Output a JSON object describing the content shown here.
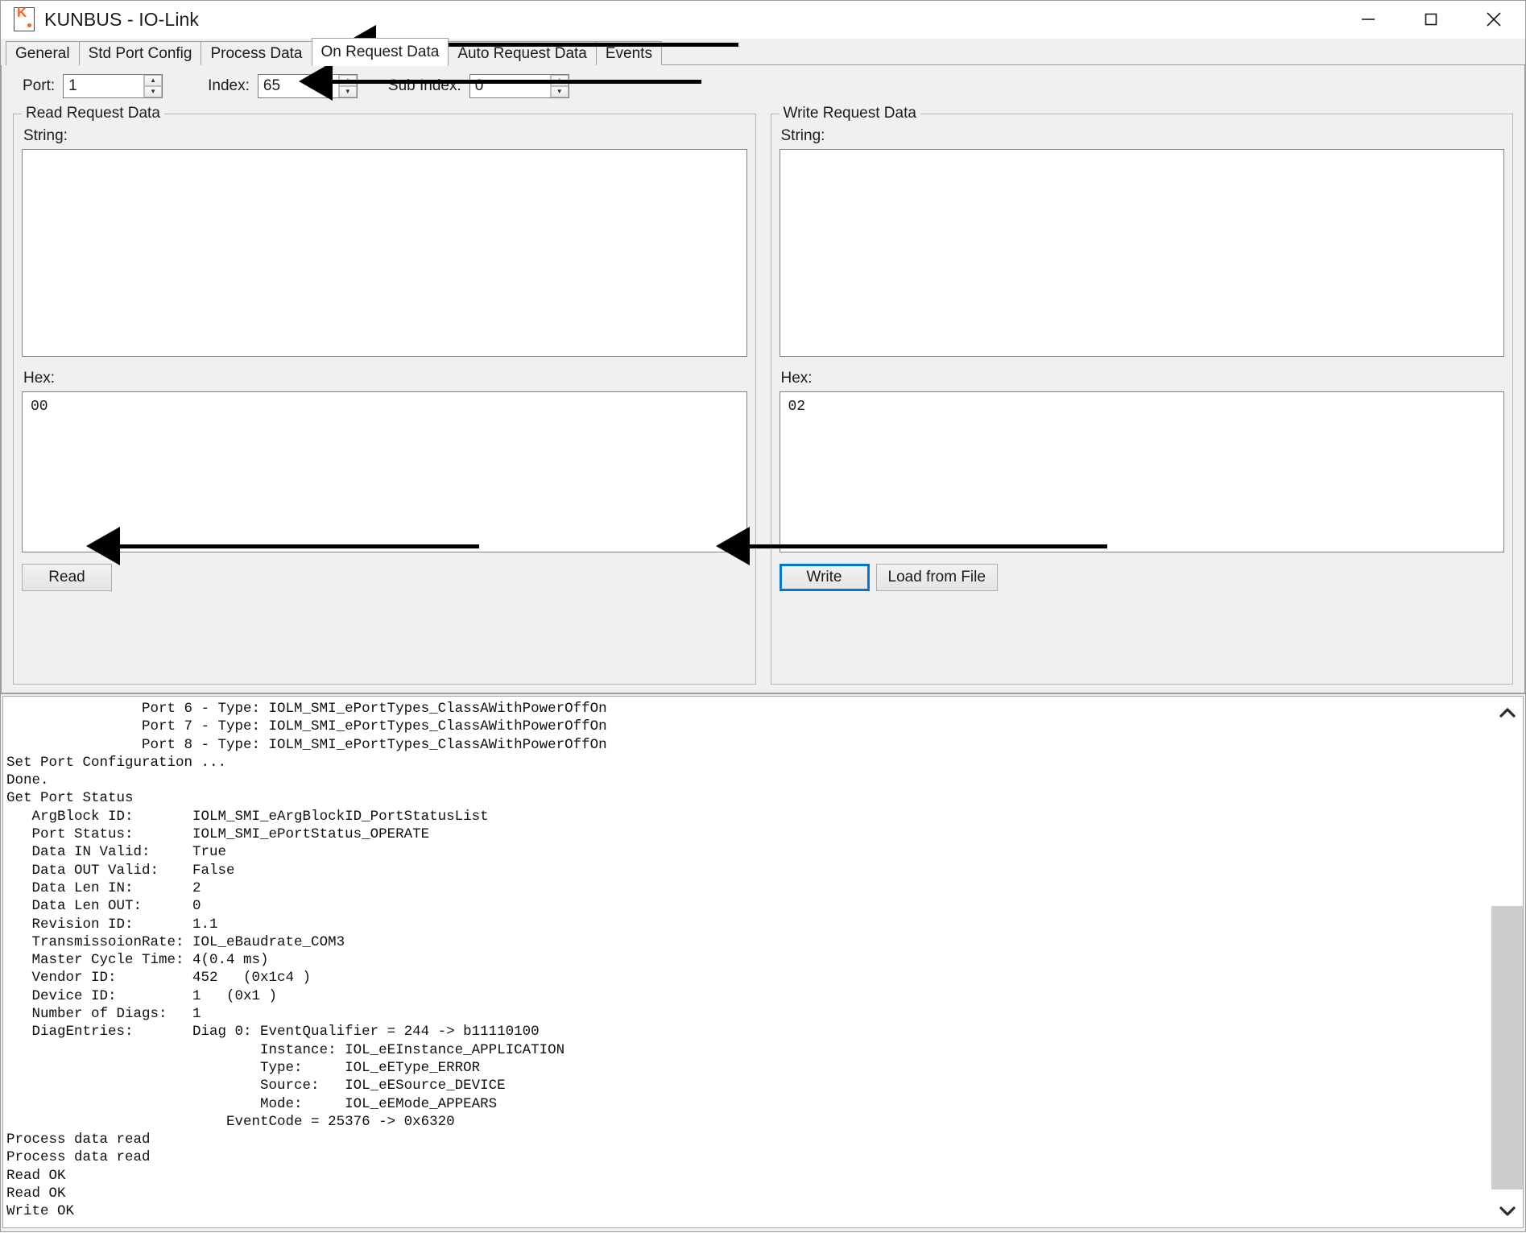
{
  "window": {
    "title": "KUNBUS - IO-Link",
    "icon": "kunbus-logo-icon",
    "controls": {
      "minimize": "minimize-icon",
      "maximize": "maximize-icon",
      "close": "close-icon"
    }
  },
  "tabs": [
    {
      "label": "General",
      "active": false
    },
    {
      "label": "Std Port Config",
      "active": false
    },
    {
      "label": "Process Data",
      "active": false
    },
    {
      "label": "On Request Data",
      "active": true
    },
    {
      "label": "Auto Request Data",
      "active": false
    },
    {
      "label": "Events",
      "active": false
    }
  ],
  "toolbar": {
    "port": {
      "label": "Port:",
      "value": "1"
    },
    "index": {
      "label": "Index:",
      "value": "65"
    },
    "sub_index": {
      "label": "Sub Index:",
      "value": "0"
    }
  },
  "read_panel": {
    "title": "Read Request Data",
    "string_label": "String:",
    "string_value": "",
    "hex_label": "Hex:",
    "hex_value": "00",
    "read_button": "Read"
  },
  "write_panel": {
    "title": "Write Request Data",
    "string_label": "String:",
    "string_value": "",
    "hex_label": "Hex:",
    "hex_value": "02",
    "write_button": "Write",
    "load_button": "Load from File"
  },
  "log": {
    "text": "                Port 6 - Type: IOLM_SMI_ePortTypes_ClassAWithPowerOffOn\n                Port 7 - Type: IOLM_SMI_ePortTypes_ClassAWithPowerOffOn\n                Port 8 - Type: IOLM_SMI_ePortTypes_ClassAWithPowerOffOn\nSet Port Configuration ...\nDone.\nGet Port Status\n   ArgBlock ID:       IOLM_SMI_eArgBlockID_PortStatusList\n   Port Status:       IOLM_SMI_ePortStatus_OPERATE\n   Data IN Valid:     True\n   Data OUT Valid:    False\n   Data Len IN:       2\n   Data Len OUT:      0\n   Revision ID:       1.1\n   TransmissoionRate: IOL_eBaudrate_COM3\n   Master Cycle Time: 4(0.4 ms)\n   Vendor ID:         452   (0x1c4 )\n   Device ID:         1   (0x1 )\n   Number of Diags:   1\n   DiagEntries:       Diag 0: EventQualifier = 244 -> b11110100\n                              Instance: IOL_eEInstance_APPLICATION\n                              Type:     IOL_eEType_ERROR\n                              Source:   IOL_eESource_DEVICE\n                              Mode:     IOL_eEMode_APPEARS\n                          EventCode = 25376 -> 0x6320\nProcess data read\nProcess data read\nRead OK\nRead OK\nWrite OK",
    "scrollbar": {
      "up": "scroll-up-icon",
      "down": "scroll-down-icon"
    }
  },
  "annotations": {
    "tab_arrow": "arrow-pointing-to-on-request-data-tab",
    "index_arrow": "arrow-pointing-to-index-field",
    "read_arrow": "arrow-pointing-to-read-button",
    "write_arrow": "arrow-pointing-to-write-button"
  },
  "colors": {
    "accent": "#0078d7",
    "brand": "#f26522",
    "window_bg": "#f0f0f0"
  }
}
